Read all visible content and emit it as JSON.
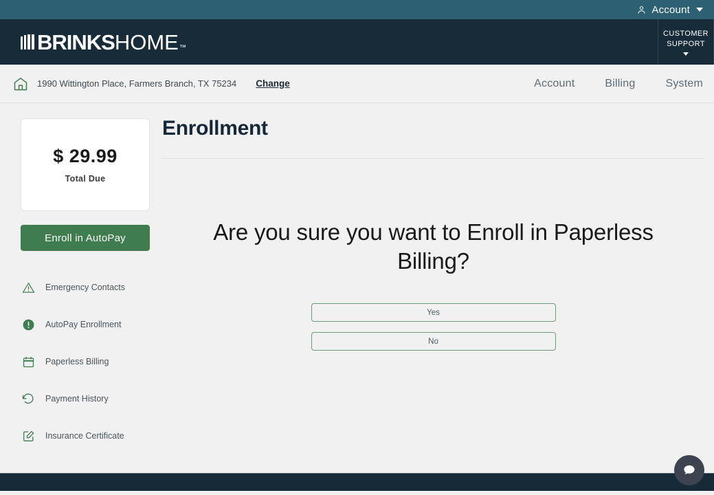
{
  "topbar": {
    "account_label": "Account",
    "person_icon": "person-icon",
    "caret_icon": "chevron-down-icon"
  },
  "header": {
    "logo_brinks": "BRINKS",
    "logo_home": "HOME",
    "logo_tm": "™",
    "support_line1": "CUSTOMER",
    "support_line2": "SUPPORT"
  },
  "subnav": {
    "home_icon": "home-icon",
    "address": "1990 Wittington Place, Farmers Branch, TX 75234",
    "change_label": "Change",
    "nav": [
      {
        "label": "Account"
      },
      {
        "label": "Billing"
      },
      {
        "label": "System"
      }
    ]
  },
  "sidebar": {
    "due_amount": "$ 29.99",
    "due_label": "Total Due",
    "autopay_button": "Enroll in AutoPay",
    "items": [
      {
        "label": "Emergency Contacts",
        "icon": "warning-triangle-icon"
      },
      {
        "label": "AutoPay Enrollment",
        "icon": "alert-circle-icon"
      },
      {
        "label": "Paperless Billing",
        "icon": "calendar-icon"
      },
      {
        "label": "Payment History",
        "icon": "history-icon"
      },
      {
        "label": "Insurance Certificate",
        "icon": "edit-square-icon"
      }
    ]
  },
  "main": {
    "page_title": "Enrollment",
    "question": "Are you sure you want to Enroll in Paperless Billing?",
    "yes_label": "Yes",
    "no_label": "No"
  },
  "chat": {
    "icon": "chat-bubble-icon"
  },
  "colors": {
    "topbar": "#2c6072",
    "header": "#172b39",
    "page_bg": "#f0f1f0",
    "green": "#3f7d4f",
    "green_border": "#6d9a78",
    "title": "#16293a"
  }
}
